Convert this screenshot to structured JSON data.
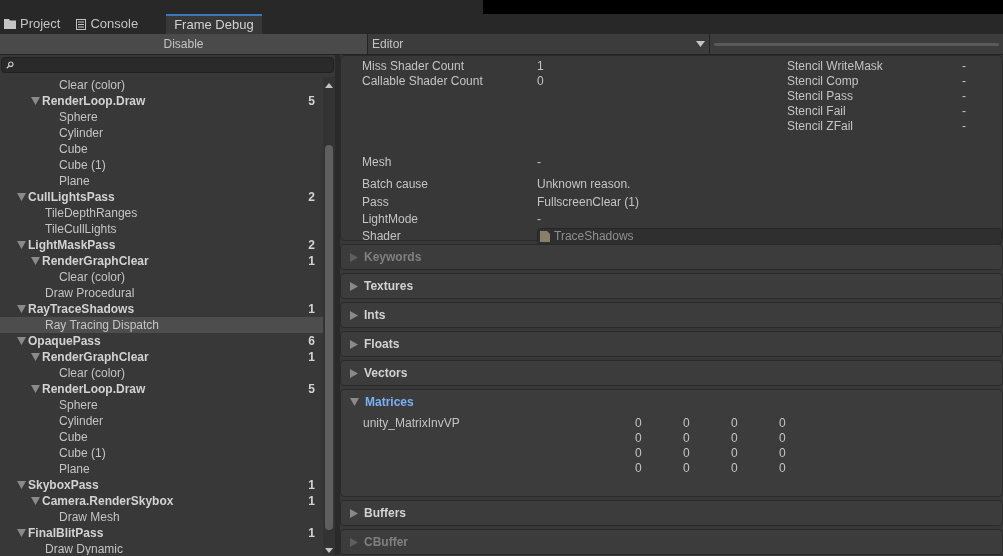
{
  "tabs": [
    {
      "label": "Project",
      "kind": "folder",
      "selected": false
    },
    {
      "label": "Console",
      "kind": "console",
      "selected": false
    },
    {
      "label": "Frame Debug",
      "kind": "plain",
      "selected": true
    }
  ],
  "toolbar": {
    "disable_button": "Disable",
    "target_dropdown": "Editor"
  },
  "tree": [
    {
      "children": [
        {
          "children": [
            {
              "label": "Clear (color)",
              "selected": false
            }
          ]
        },
        {
          "label": "RenderLoop.Draw",
          "count": "5",
          "expanded": true,
          "selected": false,
          "children": [
            {
              "label": "Sphere",
              "selected": false
            },
            {
              "label": "Cylinder",
              "selected": false
            },
            {
              "label": "Cube",
              "selected": false
            },
            {
              "label": "Cube (1)",
              "selected": false
            },
            {
              "label": "Plane",
              "selected": false
            }
          ]
        }
      ]
    },
    {
      "label": "CullLightsPass",
      "count": "2",
      "expanded": true,
      "selected": false,
      "children": [
        {
          "label": "TileDepthRanges",
          "selected": false
        },
        {
          "label": "TileCullLights",
          "selected": false
        }
      ]
    },
    {
      "label": "LightMaskPass",
      "count": "2",
      "expanded": true,
      "selected": false,
      "children": [
        {
          "label": "RenderGraphClear",
          "count": "1",
          "expanded": true,
          "selected": false,
          "children": [
            {
              "label": "Clear (color)",
              "selected": false
            }
          ]
        },
        {
          "label": "Draw Procedural",
          "selected": false
        }
      ]
    },
    {
      "label": "RayTraceShadows",
      "count": "1",
      "expanded": true,
      "selected": false,
      "children": [
        {
          "label": "Ray Tracing Dispatch",
          "selected": true
        }
      ]
    },
    {
      "label": "OpaquePass",
      "count": "6",
      "expanded": true,
      "selected": false,
      "children": [
        {
          "label": "RenderGraphClear",
          "count": "1",
          "expanded": true,
          "selected": false,
          "children": [
            {
              "label": "Clear (color)",
              "selected": false
            }
          ]
        },
        {
          "label": "RenderLoop.Draw",
          "count": "5",
          "expanded": true,
          "selected": false,
          "children": [
            {
              "label": "Sphere",
              "selected": false
            },
            {
              "label": "Cylinder",
              "selected": false
            },
            {
              "label": "Cube",
              "selected": false
            },
            {
              "label": "Cube (1)",
              "selected": false
            },
            {
              "label": "Plane",
              "selected": false
            }
          ]
        }
      ]
    },
    {
      "label": "SkyboxPass",
      "count": "1",
      "expanded": true,
      "selected": false,
      "children": [
        {
          "label": "Camera.RenderSkybox",
          "count": "1",
          "expanded": true,
          "selected": false,
          "children": [
            {
              "label": "Draw Mesh",
              "selected": false
            }
          ]
        }
      ]
    },
    {
      "label": "FinalBlitPass",
      "count": "1",
      "expanded": true,
      "selected": false,
      "children": [
        {
          "label": "Draw Dynamic",
          "selected": false
        }
      ]
    }
  ],
  "details": {
    "left_properties": [
      {
        "label": "Miss Shader Count",
        "value": "1"
      },
      {
        "label": "Callable Shader Count",
        "value": "0"
      }
    ],
    "stencil_properties": [
      {
        "label": "Stencil WriteMask",
        "value": "-"
      },
      {
        "label": "Stencil Comp",
        "value": "-"
      },
      {
        "label": "Stencil Pass",
        "value": "-"
      },
      {
        "label": "Stencil Fail",
        "value": "-"
      },
      {
        "label": "Stencil ZFail",
        "value": "-"
      }
    ],
    "properties": [
      {
        "label": "Mesh",
        "value": "-",
        "kind": "text"
      },
      {
        "label": "Batch cause",
        "value": "Unknown reason.",
        "kind": "text"
      },
      {
        "label": "Pass",
        "value": "FullscreenClear (1)",
        "kind": "text"
      },
      {
        "label": "LightMode",
        "value": "-",
        "kind": "text"
      },
      {
        "label": "Shader",
        "value": "TraceShadows",
        "kind": "object"
      }
    ]
  },
  "sections": [
    {
      "title": "Keywords",
      "expanded": false,
      "disabled": true
    },
    {
      "title": "Textures",
      "expanded": false,
      "disabled": false
    },
    {
      "title": "Ints",
      "expanded": false,
      "disabled": false
    },
    {
      "title": "Floats",
      "expanded": false,
      "disabled": false
    },
    {
      "title": "Vectors",
      "expanded": false,
      "disabled": false
    },
    {
      "title": "Matrices",
      "expanded": true,
      "disabled": false,
      "matrices": [
        {
          "name": "unity_MatrixInvVP",
          "rows": [
            [
              "0",
              "0",
              "0",
              "0"
            ],
            [
              "0",
              "0",
              "0",
              "0"
            ],
            [
              "0",
              "0",
              "0",
              "0"
            ],
            [
              "0",
              "0",
              "0",
              "0"
            ]
          ]
        }
      ]
    },
    {
      "title": "Buffers",
      "expanded": false,
      "disabled": false
    },
    {
      "title": "CBuffer",
      "expanded": false,
      "disabled": true
    }
  ]
}
